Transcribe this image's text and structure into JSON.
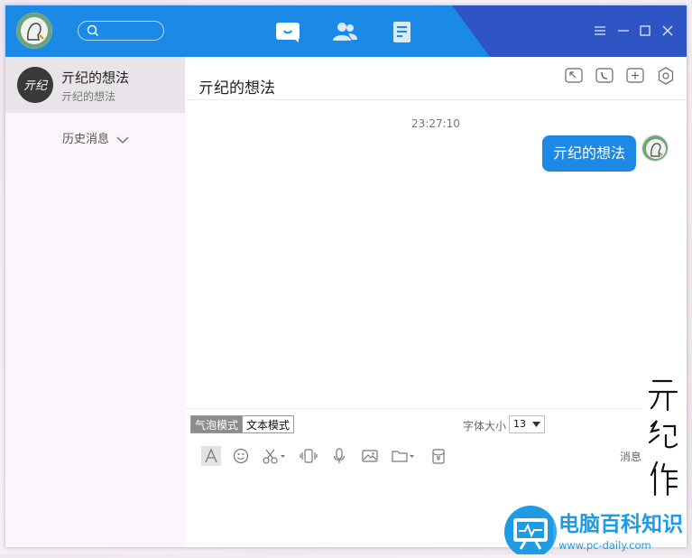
{
  "topbar": {
    "search_placeholder": "",
    "nav": [
      {
        "icon": "message-icon"
      },
      {
        "icon": "contacts-icon"
      },
      {
        "icon": "notes-icon"
      }
    ],
    "window_controls": [
      "menu-icon",
      "minimize-icon",
      "maximize-icon",
      "close-icon"
    ],
    "accent": "#1b8ae6",
    "accent_dark": "#2f54c4"
  },
  "sidebar": {
    "conversation": {
      "name": "亓纪的想法",
      "preview": "亓纪的想法",
      "avatar_text": "亓纪"
    },
    "history_label": "历史消息"
  },
  "chat": {
    "title": "亓纪的想法",
    "header_icons": [
      "screen-share-icon",
      "phone-icon",
      "add-member-icon",
      "settings-icon"
    ],
    "timestamp": "23:27:10",
    "messages": [
      {
        "text": "亓纪的想法",
        "from": "me",
        "color": "#1e88e5"
      }
    ]
  },
  "input": {
    "mode_bubble": "气泡模式",
    "mode_text": "文本模式",
    "font_size_label": "字体大小",
    "font_size": "13",
    "tools": [
      "font-icon",
      "emoji-icon",
      "scissors-icon",
      "shake-icon",
      "mic-icon",
      "image-icon",
      "folder-icon",
      "red-envelope-icon"
    ],
    "message_label": "消息:"
  },
  "watermark": {
    "handwriting": "亓纪作",
    "brand_name": "电脑百科知识",
    "brand_url": "www.pc-daily.com"
  }
}
